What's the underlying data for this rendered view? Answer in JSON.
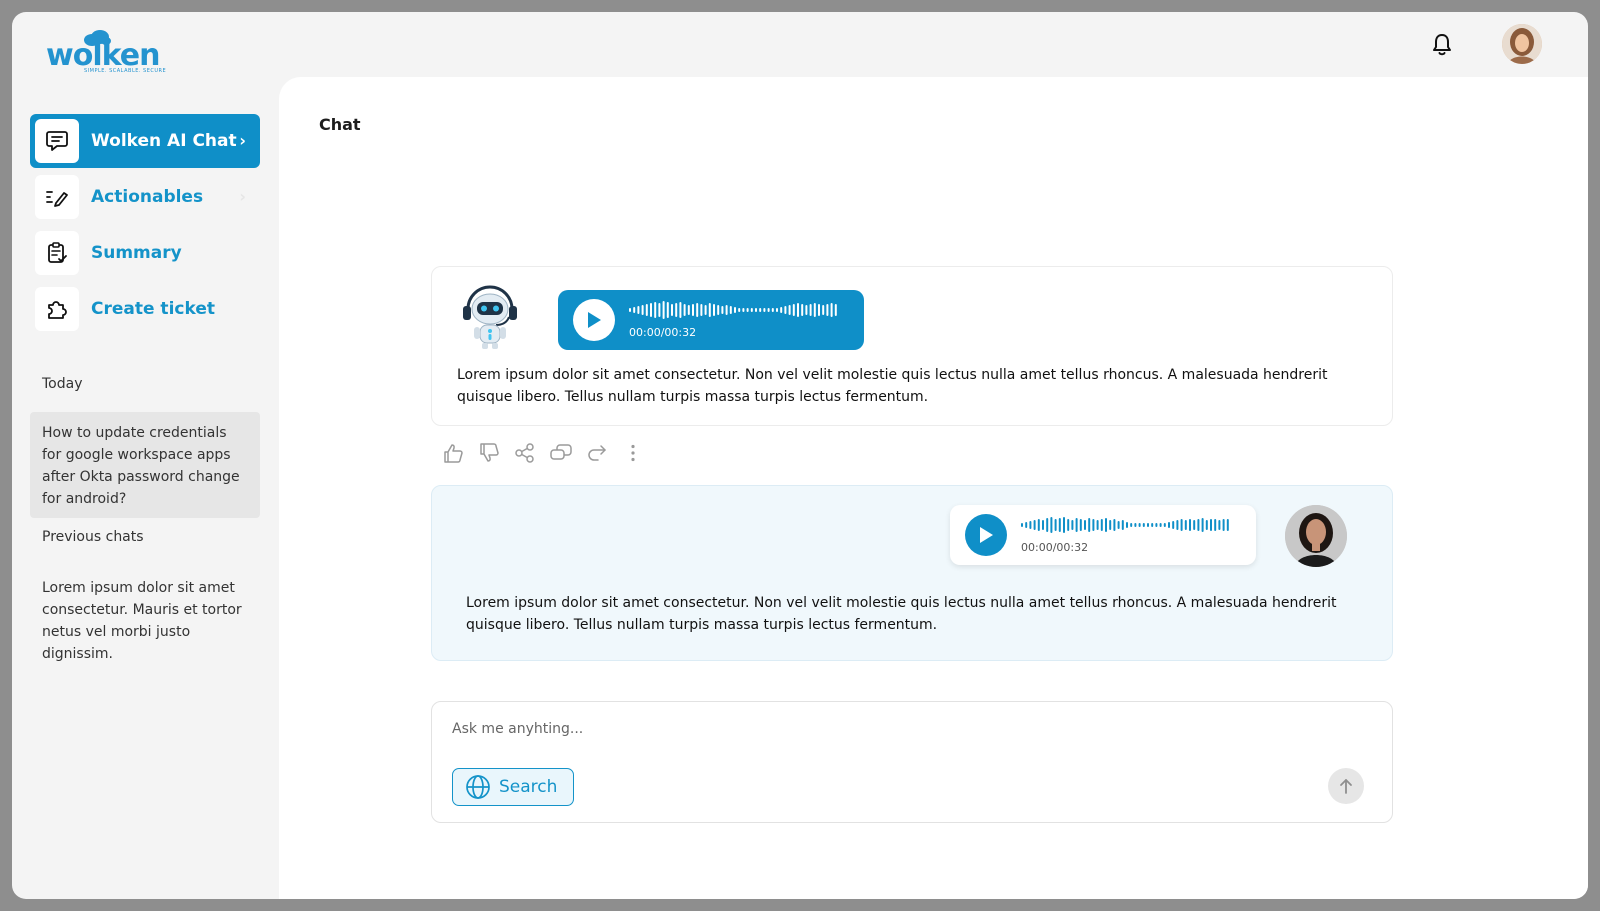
{
  "brand": {
    "logo_text": "wolken",
    "tagline": "SIMPLE. SCALABLE. SECURE"
  },
  "sidebar": {
    "items": [
      {
        "label": "Wolken AI Chat",
        "icon": "chat-icon",
        "active": true
      },
      {
        "label": "Actionables",
        "icon": "checklist-pen-icon",
        "active": false
      },
      {
        "label": "Summary",
        "icon": "clipboard-check-icon",
        "active": false
      },
      {
        "label": "Create ticket",
        "icon": "puzzle-icon",
        "active": false
      }
    ],
    "today_label": "Today",
    "today_chat": "How to update credentials for google workspace apps after Okta password change for android?",
    "previous_label": "Previous chats",
    "previous_chat": "Lorem ipsum dolor sit amet consectetur. Mauris et tortor netus vel morbi justo dignissim."
  },
  "main": {
    "title": "Chat",
    "bot_message": {
      "audio_time": "00:00/00:32",
      "text": "Lorem ipsum dolor sit amet consectetur. Non vel velit molestie quis lectus nulla amet tellus rhoncus. A malesuada hendrerit quisque libero. Tellus nullam turpis massa turpis lectus fermentum."
    },
    "user_message": {
      "audio_time": "00:00/00:32",
      "text": "Lorem ipsum dolor sit amet consectetur. Non vel velit molestie quis lectus nulla amet tellus rhoncus. A malesuada hendrerit quisque libero. Tellus nullam turpis massa turpis lectus fermentum."
    },
    "actions": [
      "thumbs-up-icon",
      "thumbs-down-icon",
      "share-icon",
      "copy-icon",
      "forward-icon",
      "more-vertical-icon"
    ],
    "composer": {
      "placeholder": "Ask me anyhting...",
      "search_label": "Search"
    }
  },
  "colors": {
    "accent": "#0f8fc8",
    "user_bubble": "#f0f8fc",
    "sidebar_bg": "#f4f4f4"
  }
}
